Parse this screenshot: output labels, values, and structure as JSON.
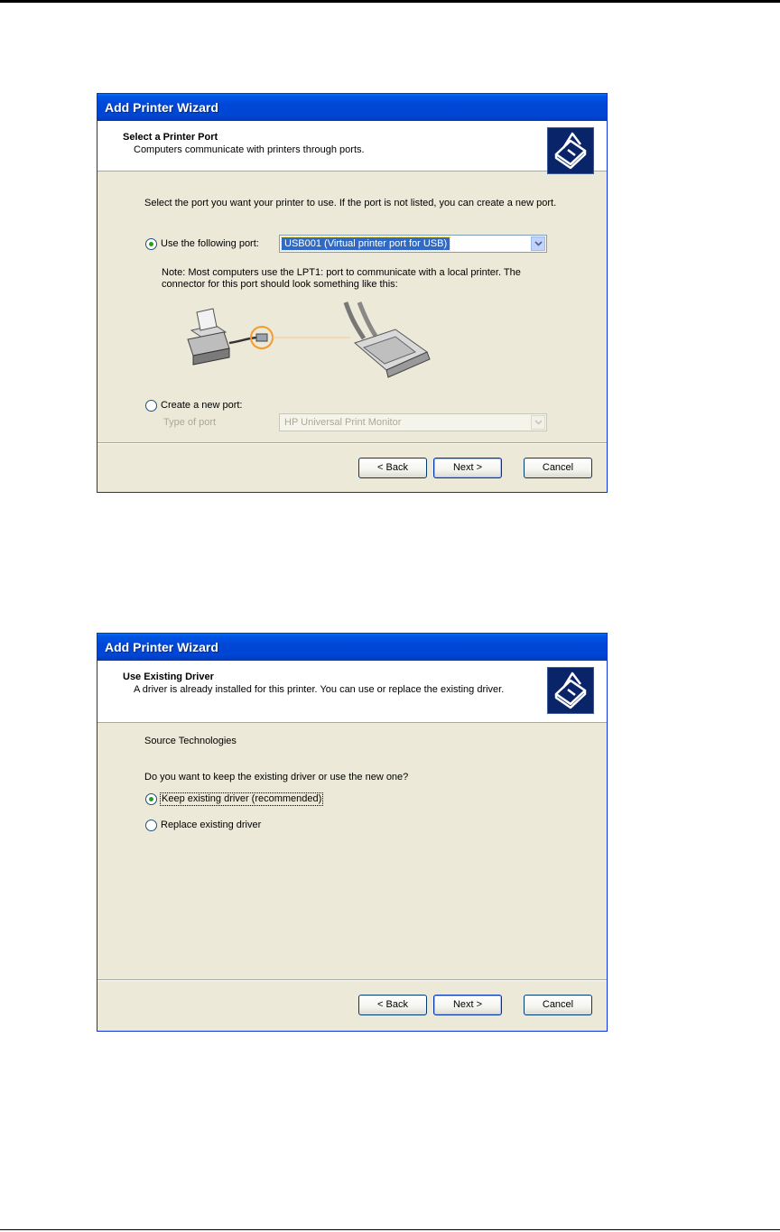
{
  "dialog1": {
    "title": "Add Printer Wizard",
    "header_title": "Select a Printer Port",
    "header_subtitle": "Computers communicate with printers through ports.",
    "intro": "Select the port you want your printer to use.  If the port is not listed, you can create a new port.",
    "use_port_label": "Use the following port:",
    "use_port_value": "USB001 (Virtual printer port for USB)",
    "note": "Note: Most computers use the LPT1: port to communicate with a local printer. The connector for this port should look something like this:",
    "create_port_label": "Create a new port:",
    "type_of_port_label": "Type of port",
    "type_of_port_value": "HP Universal Print Monitor",
    "back": "< Back",
    "next": "Next >",
    "cancel": "Cancel"
  },
  "dialog2": {
    "title": "Add Printer Wizard",
    "header_title": "Use Existing Driver",
    "header_subtitle": "A driver is already installed for this printer. You can use or replace the existing driver.",
    "printer_name": "Source Technologies",
    "question": "Do you want to keep the existing driver or use the new one?",
    "keep_label": "Keep existing driver (recommended)",
    "replace_label": "Replace existing driver",
    "back": "< Back",
    "next": "Next >",
    "cancel": "Cancel"
  },
  "icons": {
    "header_icon": "printer-wizard-icon",
    "port_illustration": "printer-cable-connector-illustration"
  },
  "colors": {
    "titlebar": "#0055e5",
    "dialog_bg": "#ece9d8",
    "selection": "#316ac5"
  }
}
